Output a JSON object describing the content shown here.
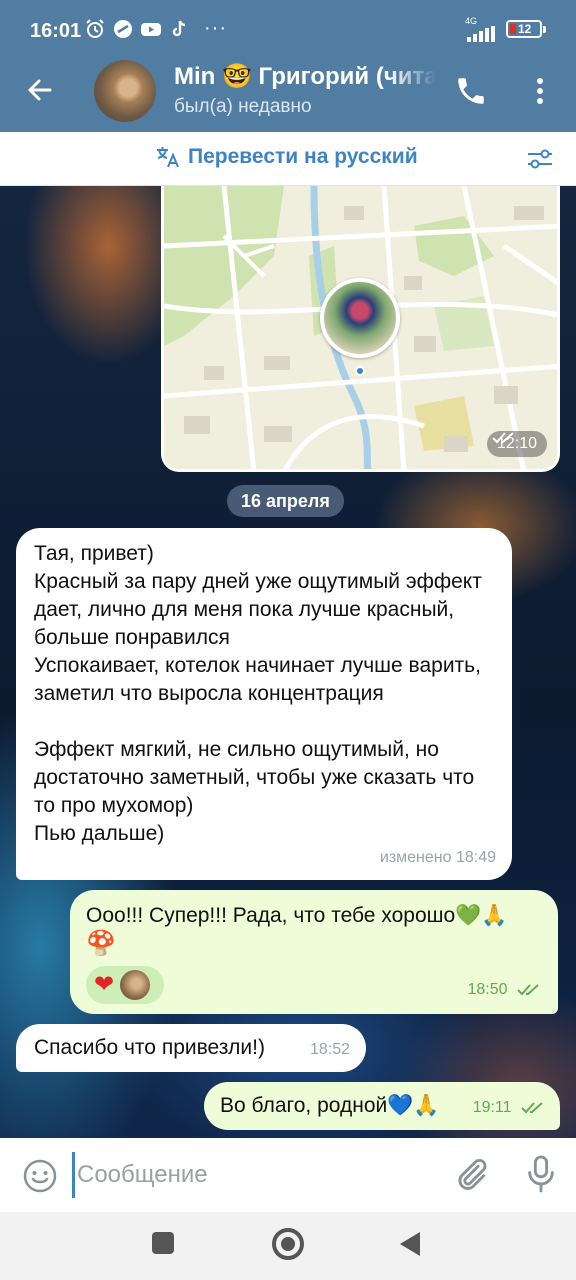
{
  "status_bar": {
    "time": "16:01",
    "network": "4G",
    "battery": "12",
    "more": "···",
    "battery_color": "#e0301e"
  },
  "header": {
    "title": "Min 🤓 Григорий (читает)",
    "subtitle": "был(а) недавно",
    "bg_color": "#527da3"
  },
  "translate_bar": {
    "label": "Перевести на русский",
    "accent": "#3e83c4"
  },
  "map_message": {
    "time": "12:10"
  },
  "date_separator": "16 апреля",
  "messages": [
    {
      "direction": "incoming",
      "text": "Тая, привет)\nКрасный за пару дней уже ощутимый эффект дает, лично для меня пока лучше красный, больше понравился\nУспокаивает, котелок начинает лучше варить, заметил что выросла концентрация\n\nЭффект мягкий, не сильно ощутимый, но достаточно заметный, чтобы уже сказать что то про мухомор)\nПью дальше)",
      "meta": "изменено 18:49"
    },
    {
      "direction": "outgoing",
      "text": "Ооо!!! Супер!!! Рада, что тебе хорошо💚🙏",
      "sticker": "🍄",
      "reaction": "❤",
      "time": "18:50"
    },
    {
      "direction": "incoming",
      "text": "Спасибо что привезли!)",
      "time": "18:52"
    },
    {
      "direction": "outgoing",
      "text": "Во благо, родной💙🙏",
      "time": "19:11"
    }
  ],
  "composer": {
    "placeholder": "Сообщение"
  },
  "colors": {
    "outgoing_bubble": "#effcd8",
    "incoming_bubble": "#ffffff",
    "read_check": "#63a958"
  }
}
